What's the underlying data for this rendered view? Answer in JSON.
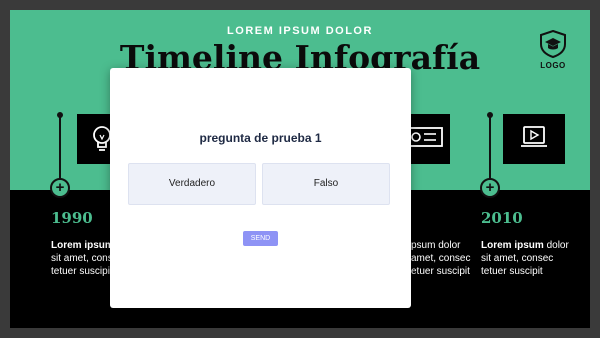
{
  "slide": {
    "subtitle": "LOREM IPSUM DOLOR",
    "title": "Timeline Infografía",
    "logo_text": "LOGO",
    "columns": [
      {
        "icon": "lightbulb-icon",
        "year": "1990",
        "text_bold": "Lorem ipsum",
        "text_line1_rest": " d",
        "text_line2": "sit amet, consec",
        "text_line3": "tetuer suscipit"
      },
      {
        "icon": "projector-icon",
        "year": "",
        "text_bold": "",
        "text_line1_rest": "psum dolor",
        "text_line2": "amet, consec",
        "text_line3": "etuer suscipit"
      },
      {
        "icon": "video-player-icon",
        "year": "2010",
        "text_bold": "Lorem ipsum",
        "text_line1_rest": " dolor",
        "text_line2": "sit amet, consec",
        "text_line3": "tetuer suscipit"
      }
    ],
    "colors": {
      "accent": "#4cbd8f",
      "dark": "#000000",
      "send": "#8e93f5"
    }
  },
  "quiz": {
    "question": "pregunta de prueba 1",
    "options": [
      "Verdadero",
      "Falso"
    ],
    "send_label": "SEND"
  }
}
